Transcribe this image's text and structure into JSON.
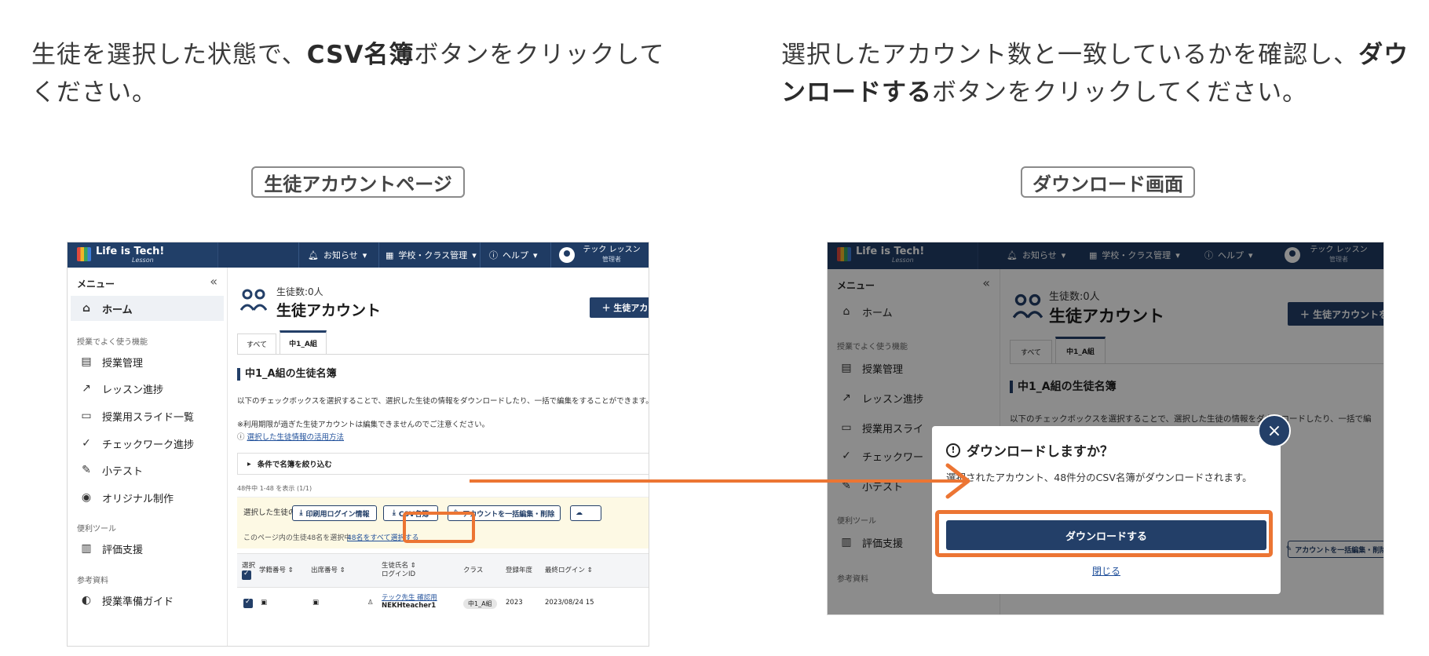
{
  "instructions": {
    "left_pre": "生徒を選択した状態で、",
    "left_bold": "CSV名簿",
    "left_post": "ボタンをクリックしてください。",
    "right_pre": "選択したアカウント数と一致しているかを確認し、",
    "right_bold": "ダウンロードする",
    "right_post": "ボタンをクリックしてください。"
  },
  "captions": {
    "left": "生徒アカウントページ",
    "right": "ダウンロード画面"
  },
  "app": {
    "logo": "Life is Tech!",
    "logo_sub": "Lesson",
    "nav": {
      "notice": "お知らせ",
      "school": "学校・クラス管理",
      "help": "ヘルプ",
      "user_name": "テック レッスン",
      "user_role": "管理者"
    }
  },
  "sidebar": {
    "menu_label": "メニュー",
    "home": "ホーム",
    "group_common": "授業でよく使う機能",
    "items": [
      "授業管理",
      "レッスン進捗",
      "授業用スライド一覧",
      "チェックワーク進捗",
      "小テスト",
      "オリジナル制作"
    ],
    "items_right": [
      "授業管理",
      "レッスン進捗",
      "授業用スライ",
      "チェックワー",
      "小テスト"
    ],
    "group_tools": "便利ツール",
    "tool_eval": "評価支援",
    "group_ref": "参考資料",
    "ref_guide": "授業準備ガイド"
  },
  "main": {
    "student_count": "生徒数:0人",
    "page_title": "生徒アカウント",
    "issue_button": "＋ 生徒アカウントを発行",
    "tabs": [
      "すべて",
      "中1_A組"
    ],
    "section_title": "中1_A組の生徒名簿",
    "desc1": "以下のチェックボックスを選択することで、選択した生徒の情報をダウンロードしたり、一括で編集をすることができます。",
    "desc1_right": "以下のチェックボックスを選択することで、選択した生徒の情報をダウンロードしたり、一括で編",
    "desc2": "※利用期限が過ぎた生徒アカウントは編集できませんのでご注意ください。",
    "help_link": "選択した生徒情報の活用方法",
    "filter_label": "条件で名簿を絞り込む",
    "showing": "48件中 1-48 を表示 (1/1)",
    "selected_label": "選択した生徒の",
    "btn_print": "印刷用ログイン情報",
    "btn_csv": "CSV名簿",
    "btn_bulk": "アカウントを一括編集・削除",
    "page_selected": "このページ内の生徒48名を選択中",
    "select_all_link": "48名をすべて選択する",
    "columns": {
      "select": "選択",
      "student_no": "学籍番号",
      "attend_no": "出席番号",
      "name": "生徒氏名",
      "login_id": "ログインID",
      "class": "クラス",
      "year": "登録年度",
      "last_login": "最終ログイン"
    },
    "row": {
      "name": "テック先生 確認用",
      "login_id": "NEKHteacher1",
      "class": "中1_A組",
      "year": "2023",
      "last_login": "2023/08/24 15"
    }
  },
  "modal": {
    "title": "ダウンロードしますか？",
    "body": "選択されたアカウント、48件分のCSV名簿がダウンロードされます。",
    "download_button": "ダウンロードする",
    "close_link": "閉じる",
    "close_icon": "×"
  },
  "colors": {
    "navy": "#233f68",
    "accent": "#ec7533"
  }
}
